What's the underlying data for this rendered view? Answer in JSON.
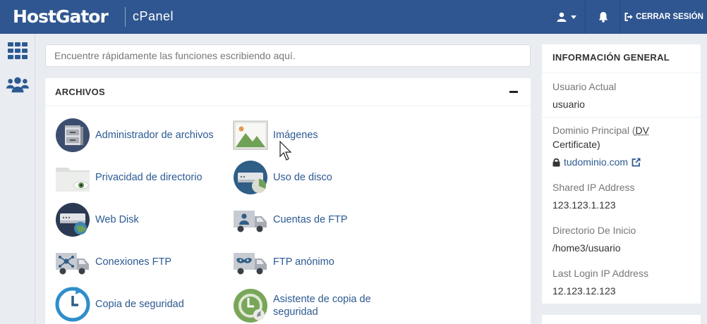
{
  "header": {
    "brand": "HostGator",
    "product": "cPanel",
    "user_icon": "user-icon",
    "bell_icon": "bell-icon",
    "logout_label": "CERRAR SESIÓN",
    "colors": {
      "bar": "#2f5690",
      "link": "#2c5a92"
    }
  },
  "rail": {
    "items": [
      {
        "icon": "grid-icon"
      },
      {
        "icon": "users-icon"
      }
    ]
  },
  "search": {
    "placeholder": "Encuentre rápidamente las funciones escribiendo aquí."
  },
  "files": {
    "title": "ARCHIVOS",
    "tools": [
      {
        "label": "Administrador de archivos",
        "icon": "file-manager-icon"
      },
      {
        "label": "Imágenes",
        "icon": "images-icon"
      },
      {
        "label": "Privacidad de directorio",
        "icon": "directory-privacy-icon"
      },
      {
        "label": "Uso de disco",
        "icon": "disk-usage-icon"
      },
      {
        "label": "Web Disk",
        "icon": "web-disk-icon"
      },
      {
        "label": "Cuentas de FTP",
        "icon": "ftp-accounts-icon"
      },
      {
        "label": "Conexiones FTP",
        "icon": "ftp-connections-icon"
      },
      {
        "label": "FTP anónimo",
        "icon": "anonymous-ftp-icon"
      },
      {
        "label": "Copia de seguridad",
        "icon": "backup-icon"
      },
      {
        "label": "Asistente de copia de seguridad",
        "icon": "backup-wizard-icon"
      }
    ]
  },
  "general_info": {
    "title": "INFORMACIÓN GENERAL",
    "current_user_label": "Usuario Actual",
    "current_user": "usuario",
    "main_domain_label": "Dominio Principal (",
    "dv_label": "DV",
    "main_domain_label_end": "Certificate)",
    "main_domain": "tudominio.com",
    "shared_ip_label": "Shared IP Address",
    "shared_ip": "123.123.1.123",
    "home_dir_label": "Directorio De Inicio",
    "home_dir": "/home3/usuario",
    "last_login_label": "Last Login IP Address",
    "last_login": "12.123.12.123"
  }
}
